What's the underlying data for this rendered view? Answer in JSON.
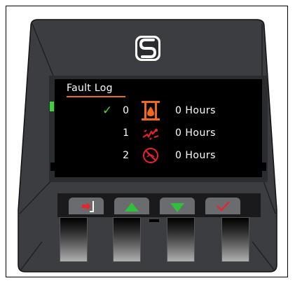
{
  "screen": {
    "title": "Fault Log",
    "rows": [
      {
        "index": "0",
        "checked": true,
        "icon": "pump-drop-icon",
        "value": "0 Hours"
      },
      {
        "index": "1",
        "checked": false,
        "icon": "broken-part-icon",
        "value": "0 Hours"
      },
      {
        "index": "2",
        "checked": false,
        "icon": "crossed-circle-icon",
        "value": "0 Hours"
      }
    ]
  },
  "keys": [
    {
      "name": "back-key",
      "icon": "exit-arrow-icon"
    },
    {
      "name": "up-key",
      "icon": "triangle-up-icon"
    },
    {
      "name": "down-key",
      "icon": "triangle-down-icon"
    },
    {
      "name": "confirm-key",
      "icon": "checkmark-icon"
    }
  ],
  "colors": {
    "bezel": "#3b3d40",
    "screen": "#000000",
    "accent": "#f06a1e",
    "check": "#5fd03a",
    "led": "#3cd23c",
    "up_down": "#2fbf3a",
    "back_confirm": "#e8232a"
  }
}
